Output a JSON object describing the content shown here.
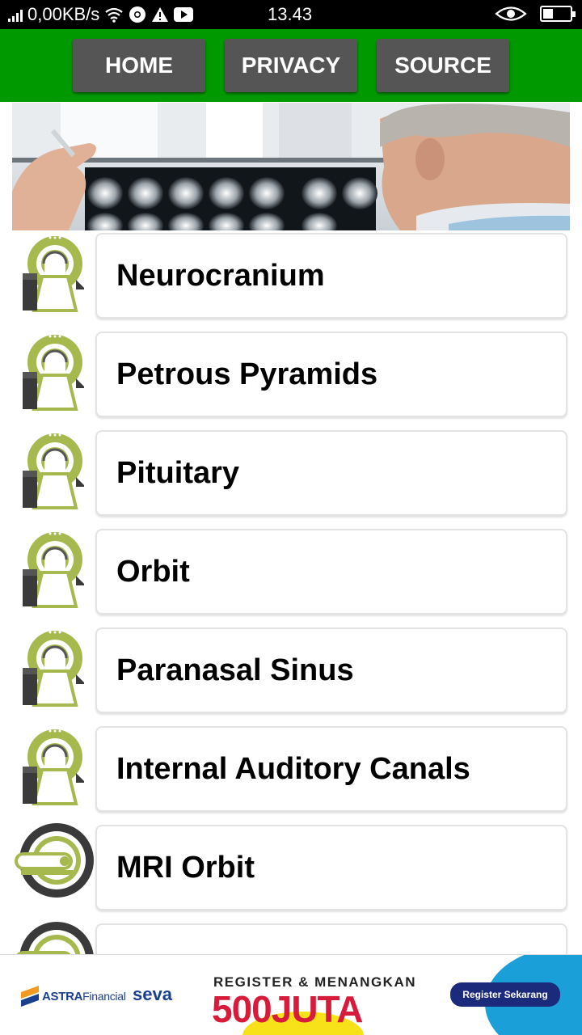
{
  "status_bar": {
    "network_speed": "0,00KB/s",
    "time": "13.43",
    "battery_level": 0.35,
    "icons": [
      "signal-icon",
      "wifi-icon",
      "chrome-icon",
      "warning-icon",
      "youtube-icon",
      "eye-icon",
      "battery-icon"
    ]
  },
  "nav": {
    "background": "#009a00",
    "buttons": [
      {
        "label": "HOME"
      },
      {
        "label": "PRIVACY"
      },
      {
        "label": "SOURCE"
      }
    ]
  },
  "list": {
    "items": [
      {
        "label": "Neurocranium",
        "icon": "ct-scanner-icon"
      },
      {
        "label": "Petrous Pyramids",
        "icon": "ct-scanner-icon"
      },
      {
        "label": "Pituitary",
        "icon": "ct-scanner-icon"
      },
      {
        "label": "Orbit",
        "icon": "ct-scanner-icon"
      },
      {
        "label": "Paranasal Sinus",
        "icon": "ct-scanner-icon"
      },
      {
        "label": "Internal Auditory Canals",
        "icon": "ct-scanner-icon"
      },
      {
        "label": "MRI Orbit",
        "icon": "mri-scanner-icon"
      },
      {
        "label": "",
        "icon": "mri-scanner-icon"
      }
    ]
  },
  "ad": {
    "astra_brand": "ASTRA",
    "astra_sub": "Financial",
    "seva_brand": "seva",
    "headline": "REGISTER & MENANGKAN",
    "amount": "500JUTA",
    "cta": "Register Sekarang"
  }
}
